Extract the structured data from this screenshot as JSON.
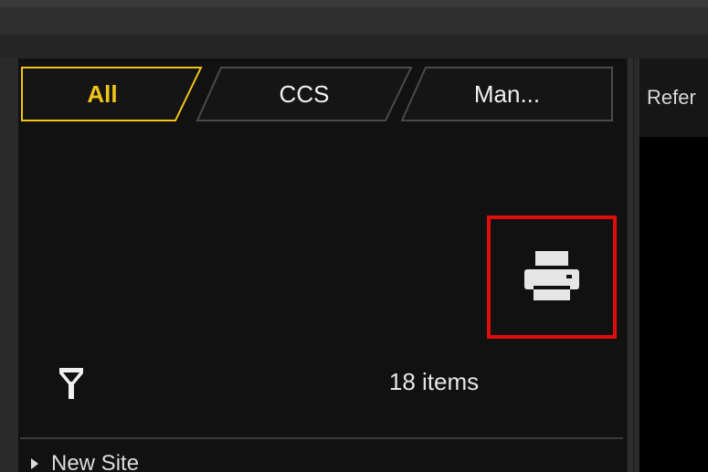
{
  "tabs": [
    {
      "label": "All",
      "active": true
    },
    {
      "label": "CCS",
      "active": false
    },
    {
      "label": "Man...",
      "active": false
    }
  ],
  "right_pane": {
    "header_text": "Refer"
  },
  "toolbar": {
    "print_icon": "printer-icon"
  },
  "filter": {
    "icon": "filter-icon"
  },
  "list": {
    "count_text": "18 items",
    "items": [
      {
        "label": "New Site",
        "icon": "caret-right-icon"
      }
    ]
  },
  "colors": {
    "active_tab_border": "#f0c419",
    "active_tab_text": "#f0c419",
    "highlight_box": "#e10c0c",
    "panel_bg": "#111111"
  }
}
